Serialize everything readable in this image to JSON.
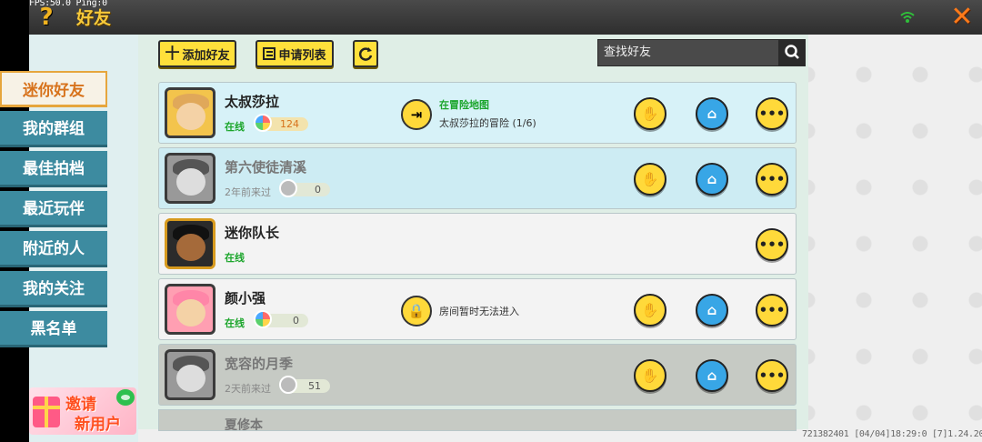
{
  "debug": {
    "text": "FPS:50.0  Ping:0"
  },
  "header": {
    "title": "好友",
    "help": "?",
    "close": "✕"
  },
  "sidebar": {
    "items": [
      {
        "label": "迷你好友",
        "active": true
      },
      {
        "label": "我的群组"
      },
      {
        "label": "最佳拍档"
      },
      {
        "label": "最近玩伴"
      },
      {
        "label": "附近的人"
      },
      {
        "label": "我的关注"
      },
      {
        "label": "黑名单"
      }
    ],
    "invite": {
      "line1": "邀请",
      "line2": "新用户"
    }
  },
  "toolbar": {
    "add_friend": "添加好友",
    "add_icon": "十",
    "request_list": "申请列表",
    "search_placeholder": "查找好友"
  },
  "friends": [
    {
      "name": "太叔莎拉",
      "status": "在线",
      "score": "124",
      "map_title": "在冒险地图",
      "map_sub": "太叔莎拉的冒险 (1/6)"
    },
    {
      "name": "第六使徒清溪",
      "status": "2年前来过",
      "score": "0"
    },
    {
      "name": "迷你队长",
      "status": "在线"
    },
    {
      "name": "颜小强",
      "status": "在线",
      "score": "0",
      "map_sub": "房间暂时无法进入"
    },
    {
      "name": "宽容的月季",
      "status": "2天前来过",
      "score": "51"
    },
    {
      "name": "夏修本"
    }
  ],
  "footer": {
    "info": "721382401  [04/04]18:29:0  [7]1.24.20"
  },
  "colors": {
    "accent": "#ffd93a",
    "online": "#1ba52b",
    "sidebar": "#3d8ba0"
  }
}
